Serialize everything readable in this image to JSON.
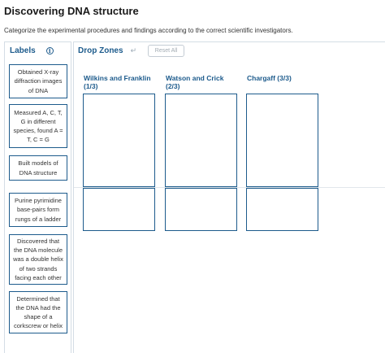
{
  "title": "Discovering DNA structure",
  "instructions": "Categorize the experimental procedures and findings according to the correct scientific investigators.",
  "labels_panel": {
    "title": "Labels",
    "info_icon": "info-icon"
  },
  "labels": [
    "Obtained X-ray diffraction images of DNA",
    "Measured A, C, T, G in different species, found A = T, C = G",
    "Built models of DNA structure",
    "Purine pyrimidine base-pairs form rungs of a ladder",
    "Discovered that the DNA molecule was a double helix of two strands facing each other",
    "Determined that the DNA had the shape of a corkscrew or helix"
  ],
  "drop_panel": {
    "title": "Drop Zones",
    "undo_icon": "undo-icon",
    "reset_label": "Reset All",
    "columns": [
      {
        "name": "Wilkins and Franklin",
        "count": "(1/3)"
      },
      {
        "name": "Watson and Crick",
        "count": "(2/3)"
      },
      {
        "name": "Chargaff (3/3)",
        "count": ""
      }
    ]
  }
}
